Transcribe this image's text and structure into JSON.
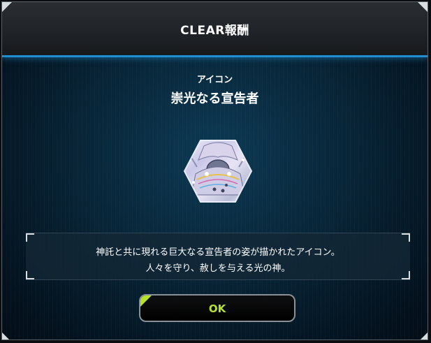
{
  "dialog": {
    "title": "CLEAR報酬",
    "reward": {
      "category": "アイコン",
      "name": "崇光なる宣告者",
      "icon": "hexagon-card-icon",
      "description_line1": "神託と共に現れる巨大なる宣告者の姿が描かれたアイコン。",
      "description_line2": "人々を守り、赦しを与える光の神。"
    },
    "ok_label": "OK"
  },
  "colors": {
    "accent_blue": "#1f8fd0",
    "ok_green": "#b8e22a",
    "panel_dark": "#082537"
  }
}
